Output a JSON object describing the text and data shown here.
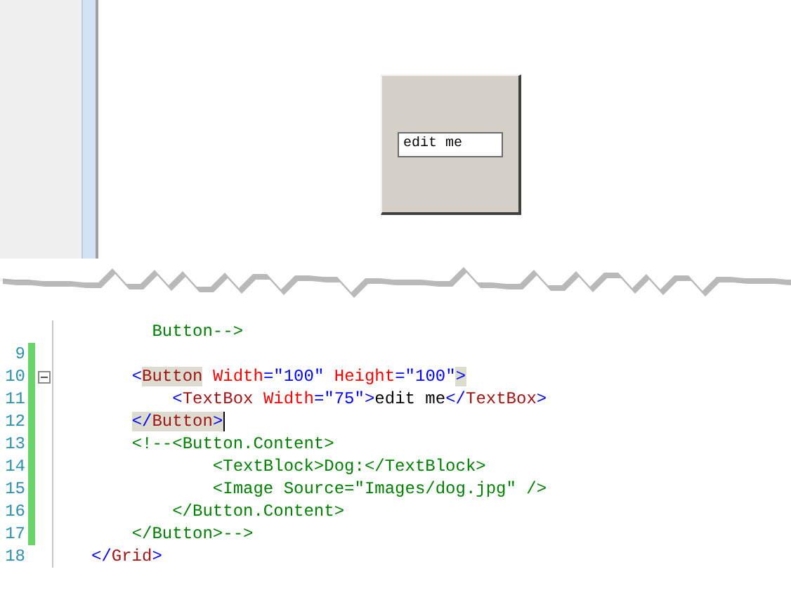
{
  "designer": {
    "button": {
      "textbox": {
        "value": "edit me"
      }
    }
  },
  "editor": {
    "lines": [
      {
        "changed": false,
        "cursor": false,
        "tokens": [
          {
            "kind": "comment",
            "text": "      Button-->",
            "highlighted": false
          }
        ]
      },
      {
        "number": "9",
        "changed": true
      },
      {
        "number": "10",
        "changed": true,
        "cursor": false,
        "fold": {
          "expanded": true
        },
        "tokens": [
          {
            "kind": "punct",
            "text": "    <",
            "highlighted": false
          },
          {
            "kind": "tag",
            "text": "Button",
            "highlighted": true
          },
          {
            "kind": "attr",
            "text": " Width",
            "highlighted": false
          },
          {
            "kind": "punct",
            "text": "=\"",
            "highlighted": false
          },
          {
            "kind": "value",
            "text": "100",
            "highlighted": false
          },
          {
            "kind": "punct",
            "text": "\"",
            "highlighted": false
          },
          {
            "kind": "attr",
            "text": " Height",
            "highlighted": false
          },
          {
            "kind": "punct",
            "text": "=\"",
            "highlighted": false
          },
          {
            "kind": "value",
            "text": "100",
            "highlighted": false
          },
          {
            "kind": "punct",
            "text": "\"",
            "highlighted": false
          },
          {
            "kind": "punct",
            "text": ">",
            "highlighted": true
          }
        ]
      },
      {
        "number": "11",
        "changed": true,
        "cursor": false,
        "tokens": [
          {
            "kind": "punct",
            "text": "        <",
            "highlighted": false
          },
          {
            "kind": "tag",
            "text": "TextBox",
            "highlighted": false
          },
          {
            "kind": "attr",
            "text": " Width",
            "highlighted": false
          },
          {
            "kind": "punct",
            "text": "=\"",
            "highlighted": false
          },
          {
            "kind": "value",
            "text": "75",
            "highlighted": false
          },
          {
            "kind": "punct",
            "text": "\">",
            "highlighted": false
          },
          {
            "kind": "text",
            "text": "edit me",
            "highlighted": false
          },
          {
            "kind": "punct",
            "text": "</",
            "highlighted": false
          },
          {
            "kind": "tag",
            "text": "TextBox",
            "highlighted": false
          },
          {
            "kind": "punct",
            "text": ">",
            "highlighted": false
          }
        ]
      },
      {
        "number": "12",
        "changed": true,
        "cursor": true,
        "tokens": [
          {
            "kind": "punct",
            "text": "    </",
            "highlighted": true
          },
          {
            "kind": "tag",
            "text": "Button",
            "highlighted": true
          },
          {
            "kind": "punct",
            "text": ">",
            "highlighted": true
          }
        ]
      },
      {
        "number": "13",
        "changed": true,
        "cursor": false,
        "tokens": [
          {
            "kind": "comment",
            "text": "    <!--<Button.Content>",
            "highlighted": false
          }
        ]
      },
      {
        "number": "14",
        "changed": true,
        "cursor": false,
        "tokens": [
          {
            "kind": "comment",
            "text": "            <TextBlock>Dog:</TextBlock>",
            "highlighted": false
          }
        ]
      },
      {
        "number": "15",
        "changed": true,
        "cursor": false,
        "tokens": [
          {
            "kind": "comment",
            "text": "            <Image Source=\"Images/dog.jpg\" />",
            "highlighted": false
          }
        ]
      },
      {
        "number": "16",
        "changed": true,
        "cursor": false,
        "tokens": [
          {
            "kind": "comment",
            "text": "        </Button.Content>",
            "highlighted": false
          }
        ]
      },
      {
        "number": "17",
        "changed": true,
        "cursor": false,
        "tokens": [
          {
            "kind": "comment",
            "text": "    </Button>-->",
            "highlighted": false
          }
        ]
      },
      {
        "number": "18",
        "changed": false,
        "cursor": false,
        "tokens": [
          {
            "kind": "punct",
            "text": "</",
            "highlighted": false
          },
          {
            "kind": "tag",
            "text": "Grid",
            "highlighted": false
          },
          {
            "kind": "punct",
            "text": ">",
            "highlighted": false
          }
        ]
      }
    ]
  }
}
